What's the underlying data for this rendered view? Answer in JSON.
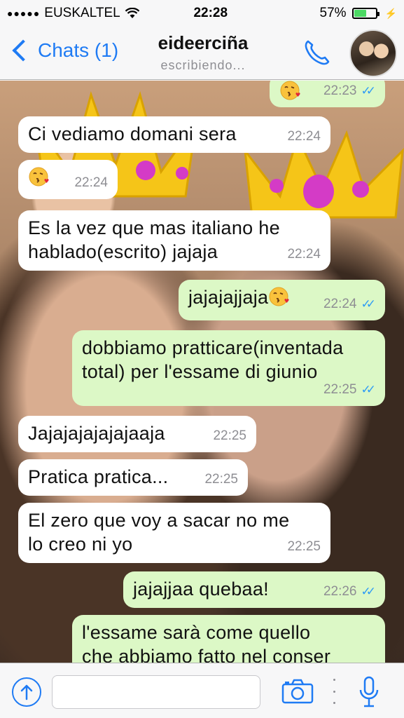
{
  "status_bar": {
    "signal_dots": "●●●●●",
    "carrier": "EUSKALTEL",
    "time": "22:28",
    "battery_percent": "57%",
    "battery_level": 0.57
  },
  "nav": {
    "back_label": "Chats (1)",
    "contact_name": "eideerciña",
    "contact_status": "escribiendo..."
  },
  "messages": [
    {
      "dir": "out",
      "text": "",
      "emoji": "kiss",
      "time": "22:23",
      "ticks": "✓✓"
    },
    {
      "dir": "in",
      "text": "Ci vediamo domani sera",
      "time": "22:24"
    },
    {
      "dir": "in",
      "text": "",
      "emoji": "kiss",
      "time": "22:24"
    },
    {
      "dir": "in",
      "text": "Es la vez que mas italiano he\nhablado(escrito)  jajaja",
      "time": "22:24"
    },
    {
      "dir": "out",
      "text": "jajajajjaja",
      "emoji": "kiss",
      "time": "22:24",
      "ticks": "✓✓"
    },
    {
      "dir": "out",
      "text": "dobbiamo pratticare(inventada\ntotal) per l'essame di giunio",
      "time": "22:25",
      "ticks": "✓✓"
    },
    {
      "dir": "in",
      "text": "Jajajajajajajaaja",
      "time": "22:25"
    },
    {
      "dir": "in",
      "text": "Pratica pratica...",
      "time": "22:25"
    },
    {
      "dir": "in",
      "text": "El zero que voy a sacar no me\nlo creo ni yo",
      "time": "22:25"
    },
    {
      "dir": "out",
      "text": "jajajjaa quebaa!",
      "time": "22:26",
      "ticks": "✓✓"
    },
    {
      "dir": "out",
      "text": "l'essame sarà come quello\nche abbiamo fatto nel conser",
      "time": "",
      "ticks": ""
    }
  ],
  "icons": {
    "back": "chevron-left-icon",
    "call": "phone-icon",
    "share": "arrow-up-circle-icon",
    "camera": "camera-icon",
    "mic": "microphone-icon"
  },
  "colors": {
    "accent": "#1f7bf4",
    "outgoing_bubble": "#dcf8c6",
    "incoming_bubble": "#ffffff",
    "read_ticks": "#2f9cf5"
  }
}
